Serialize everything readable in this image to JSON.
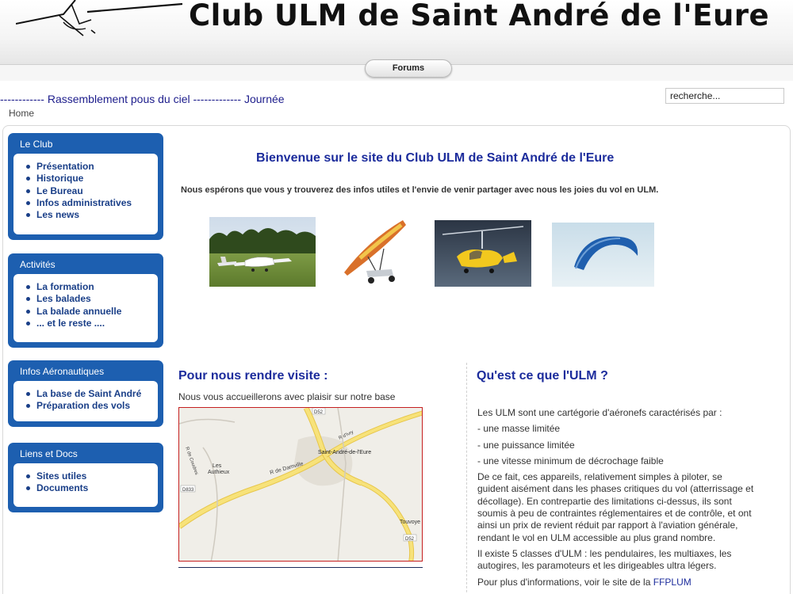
{
  "header": {
    "title": "Club ULM de Saint André de l'Eure",
    "nav_tab": "Forums"
  },
  "marquee_text": "------------ Rassemblement pous du ciel ------------- Journée",
  "search": {
    "value": "recherche..."
  },
  "breadcrumb": "Home",
  "sidebar": {
    "boxes": [
      {
        "title": "Le Club",
        "items": [
          "Présentation",
          "Historique",
          "Le Bureau",
          "Infos administratives",
          "Les news"
        ]
      },
      {
        "title": "Activités",
        "items": [
          "La formation",
          "Les balades",
          "La balade annuelle",
          "... et le reste ...."
        ]
      },
      {
        "title": "Infos Aéronautiques",
        "items": [
          "La base de Saint André",
          "Préparation des vols"
        ]
      },
      {
        "title": "Liens et Docs",
        "items": [
          "Sites utiles",
          "Documents"
        ]
      }
    ]
  },
  "main": {
    "welcome_title": "Bienvenue sur le site du Club ULM de Saint André de l'Eure",
    "welcome_text": "Nous espérons que vous y trouverez des infos utiles et l'envie de venir partager avec nous les joies du vol en ULM.",
    "visit": {
      "title": "Pour nous rendre visite :",
      "text": "Nous vous accueillerons avec plaisir sur notre base",
      "map_labels": {
        "town": "Saint-André-de-l'Eure",
        "village_1": "Les",
        "village_2": "Authieux",
        "village_3": "Touvoye",
        "road_1": "D52",
        "road_2": "D833",
        "road_3": "D52",
        "road_4": "R de Damville",
        "road_5": "R de Coudres",
        "road_6": "R d'Ivry"
      }
    },
    "ulm": {
      "title": "Qu'est ce que l'ULM ?",
      "intro": "Les ULM sont une cartégorie d'aéronefs caractérisés par :",
      "criteria": [
        "- une masse limitée",
        "- une puissance limitée",
        "- une vitesse minimum de décrochage faible"
      ],
      "paragraph": "De ce fait, ces appareils, relativement simples à piloter, se guident aisément dans les phases critiques du vol (atterrissage et décollage). En contrepartie des limitations ci-dessus, ils sont soumis à peu de contraintes réglementaires et de contrôle, et ont ainsi un prix de revient réduit par rapport à l'aviation générale, rendant le vol  en ULM accessible au plus grand nombre.",
      "classes": "Il existe 5 classes d'ULM : les pendulaires, les multiaxes, les autogires, les paramoteurs et les dirigeables ultra légers.",
      "more_prefix": "Pour plus d'informations, voir le site de la",
      "more_link": "FFPLUM"
    }
  }
}
